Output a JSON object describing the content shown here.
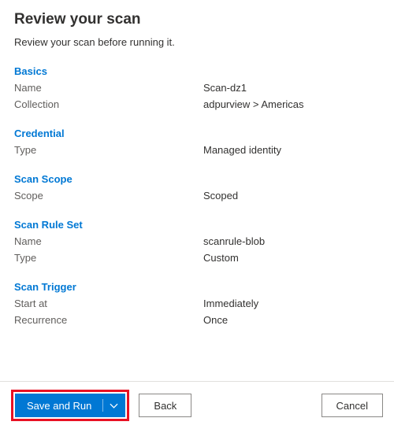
{
  "title": "Review your scan",
  "subtitle": "Review your scan before running it.",
  "sections": {
    "basics": {
      "heading": "Basics",
      "name_label": "Name",
      "name_value": "Scan-dz1",
      "collection_label": "Collection",
      "collection_value": "adpurview > Americas"
    },
    "credential": {
      "heading": "Credential",
      "type_label": "Type",
      "type_value": "Managed identity"
    },
    "scope": {
      "heading": "Scan Scope",
      "scope_label": "Scope",
      "scope_value": "Scoped"
    },
    "ruleset": {
      "heading": "Scan Rule Set",
      "name_label": "Name",
      "name_value": "scanrule-blob",
      "type_label": "Type",
      "type_value": "Custom"
    },
    "trigger": {
      "heading": "Scan Trigger",
      "start_label": "Start at",
      "start_value": "Immediately",
      "recurrence_label": "Recurrence",
      "recurrence_value": "Once"
    }
  },
  "footer": {
    "save_run": "Save and Run",
    "back": "Back",
    "cancel": "Cancel"
  }
}
